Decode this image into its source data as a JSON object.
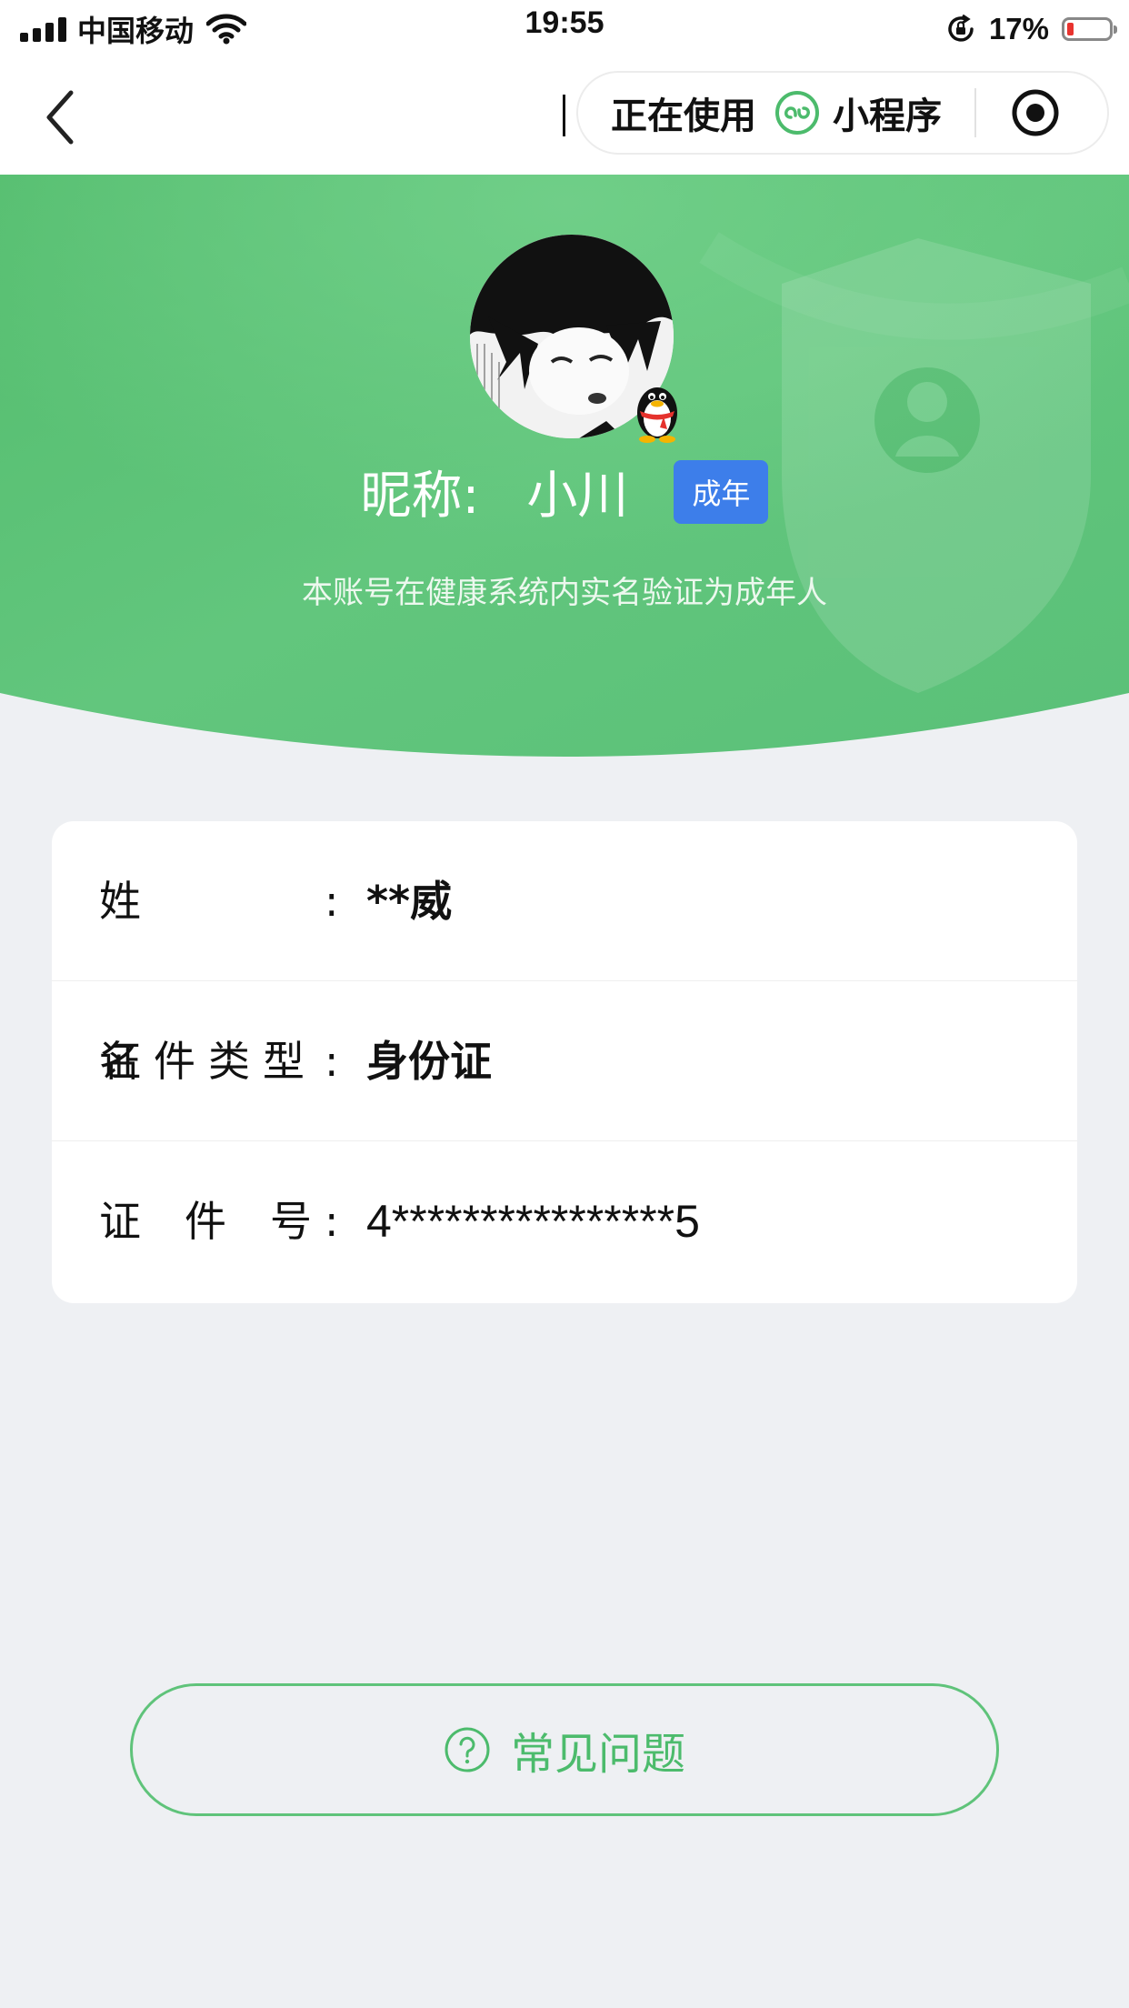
{
  "status_bar": {
    "carrier": "中国移动",
    "time": "19:55",
    "battery_percent": "17%",
    "battery_level": 0.17,
    "icons": [
      "signal-icon",
      "wifi-icon",
      "rotation-lock-icon",
      "battery-icon"
    ]
  },
  "nav": {
    "capsule_in_use": "正在使用",
    "capsule_mini_program": "小程序",
    "icons": [
      "back-icon",
      "mini-program-icon",
      "target-icon"
    ]
  },
  "profile": {
    "nickname_label": "昵称:",
    "nickname": "小川",
    "badge": "成年",
    "verification_text": "本账号在健康系统内实名验证为成年人",
    "colors": {
      "header_green": "#5cc27a",
      "badge_blue": "#3d7eea"
    }
  },
  "info": {
    "rows": [
      {
        "label": "姓名",
        "colon": ":",
        "value": "**威"
      },
      {
        "label": "证件类型",
        "colon": ":",
        "value": "身份证"
      },
      {
        "label": "证件号",
        "colon": ":",
        "value": "4****************5"
      }
    ]
  },
  "faq": {
    "label": "常见问题",
    "icon": "help-circle-icon",
    "color": "#4cbb6c"
  }
}
